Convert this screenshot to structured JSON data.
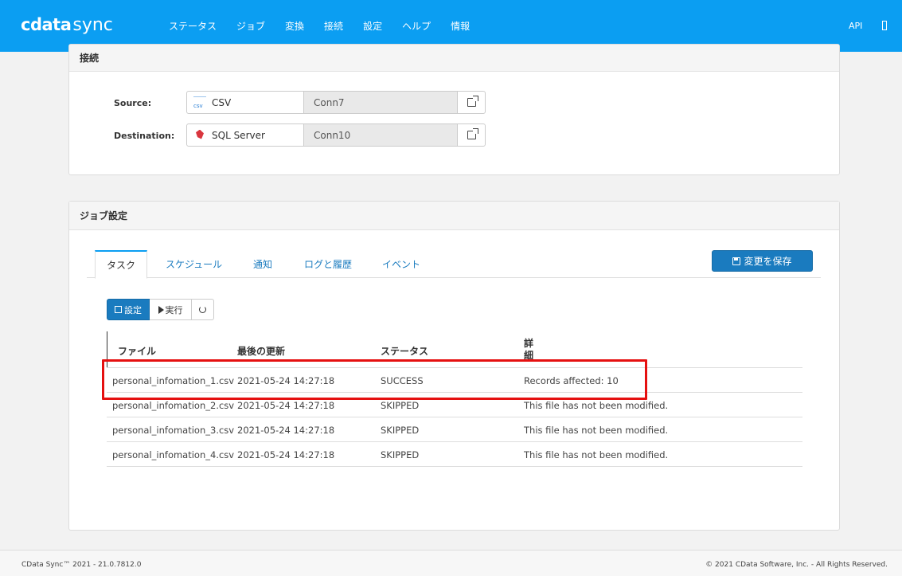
{
  "app": {
    "logo_main": "cdata",
    "logo_sub": "sync"
  },
  "nav": {
    "items": [
      "ステータス",
      "ジョブ",
      "変換",
      "接続",
      "設定",
      "ヘルプ",
      "情報"
    ],
    "api_label": "API"
  },
  "connection_panel": {
    "title": "接続",
    "source": {
      "label": "Source:",
      "type": "CSV",
      "type_icon_text": "csv",
      "name": "Conn7"
    },
    "destination": {
      "label": "Destination:",
      "type": "SQL Server",
      "name": "Conn10"
    }
  },
  "job_panel": {
    "title": "ジョブ設定",
    "tabs": [
      "タスク",
      "スケジュール",
      "通知",
      "ログと履歴",
      "イベント"
    ],
    "active_tab": "タスク",
    "save_label": "変更を保存",
    "toolbar": {
      "settings_label": "設定",
      "run_label": "実行"
    },
    "table": {
      "headers": [
        "ファイル",
        "最後の更新",
        "ステータス",
        "詳\n細"
      ],
      "rows": [
        [
          "personal_infomation_1.csv",
          "2021-05-24 14:27:18",
          "SUCCESS",
          "Records affected: 10"
        ],
        [
          "personal_infomation_2.csv",
          "2021-05-24 14:27:18",
          "SKIPPED",
          "This file has not been modified."
        ],
        [
          "personal_infomation_3.csv",
          "2021-05-24 14:27:18",
          "SKIPPED",
          "This file has not been modified."
        ],
        [
          "personal_infomation_4.csv",
          "2021-05-24 14:27:18",
          "SKIPPED",
          "This file has not been modified."
        ]
      ]
    }
  },
  "footer": {
    "left": "CData Sync™ 2021 - 21.0.7812.0",
    "right": "© 2021 CData Software, Inc. - All Rights Reserved."
  },
  "colors": {
    "topbar": "#0b9ef2",
    "primary_button": "#1a7bbf",
    "highlight": "#e51010"
  }
}
